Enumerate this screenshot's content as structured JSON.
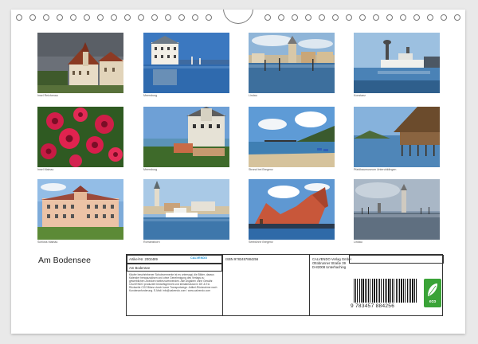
{
  "photos": [
    {
      "caption": "Insel Reichenau"
    },
    {
      "caption": "Meersburg"
    },
    {
      "caption": "Lindau"
    },
    {
      "caption": "Konstanz"
    },
    {
      "caption": "Insel Mainau"
    },
    {
      "caption": "Meersburg"
    },
    {
      "caption": "Strand bei Bregenz"
    },
    {
      "caption": "Pfahlbaumuseum Unteruhldingen"
    },
    {
      "caption": "Schloss Mainau"
    },
    {
      "caption": "Romanshorn"
    },
    {
      "caption": "Seebühne Bregenz"
    },
    {
      "caption": "Lindau"
    }
  ],
  "calendar_title": "Am Bodensee",
  "info": {
    "article_label": "Artikel-Nr. 2002489",
    "isbn": "ISBN 9783457884256",
    "title_repeat": "Am Bodensee",
    "logo_text": "CALVENDO",
    "logo_sub": "",
    "publisher_name": "CALVENDO Verlag GmbH",
    "publisher_street": "Ottobrunner Straße 39",
    "publisher_city": "D-82008 Unterhaching",
    "small_text": "Käufer beschriebener Schutzvermerke ist es untersagt, die Bilder, daraus Kalender herauszulösen und ohne Genehmigung des Verlags zu gewerblichen Zwecken weiterzuverwenden. Alle Angaben ohne Gewähr. CALVENDO produziert bedarfsgerecht und klimabewusst in DE & EU. Rückseite CO2 Bilanz durch kurze Transportwege. Artikel-Rücknahme nach Kundenanforderung. E-Mail: info@calvendo.com / www.calvendo.com",
    "barcode_number": "9 783457 884256",
    "eco_label": "eco"
  }
}
